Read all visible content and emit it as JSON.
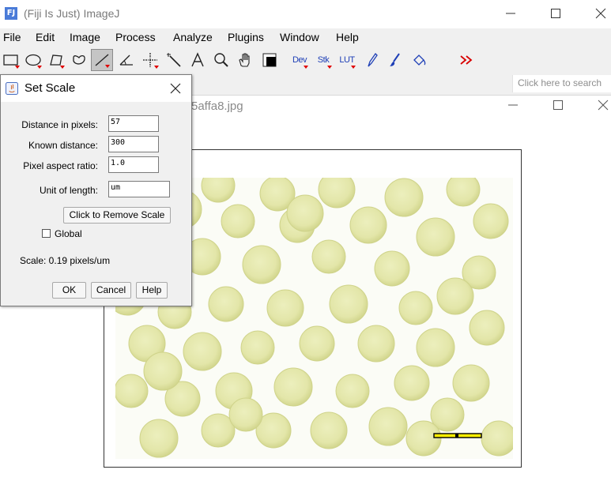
{
  "window": {
    "title": "(Fiji Is Just) ImageJ",
    "app_icon": "FJ"
  },
  "menu": [
    "File",
    "Edit",
    "Image",
    "Process",
    "Analyze",
    "Plugins",
    "Window",
    "Help"
  ],
  "toolbar": {
    "tools": [
      "rectangle-tool",
      "oval-tool",
      "polygon-tool",
      "freehand-tool",
      "line-tool",
      "angle-tool",
      "point-tool",
      "wand-tool",
      "text-tool",
      "zoom-tool",
      "hand-tool",
      "color-picker-tool"
    ],
    "dev_label": "Dev",
    "stk_label": "Stk",
    "lut_label": "LUT"
  },
  "search": {
    "placeholder": "Click here to search"
  },
  "image_window": {
    "title_partial": "5affa8.jpg"
  },
  "dialog": {
    "title": "Set Scale",
    "distance_label": "Distance in pixels:",
    "distance_value": "57",
    "known_label": "Known distance:",
    "known_value": "300",
    "aspect_label": "Pixel aspect ratio:",
    "aspect_value": "1.0",
    "unit_label": "Unit of length:",
    "unit_value": "um",
    "remove_scale_label": "Click to Remove Scale",
    "global_label": "Global",
    "global_checked": false,
    "scale_text": "Scale: 0.19 pixels/um",
    "ok_label": "OK",
    "cancel_label": "Cancel",
    "help_label": "Help"
  },
  "colors": {
    "bead_fill": "#e2e5a8",
    "bead_rim": "#cfd38a",
    "image_bg": "#fbfcf6",
    "tool_text": "#1e3fb6",
    "menu_bar": "#f0f0f0"
  }
}
